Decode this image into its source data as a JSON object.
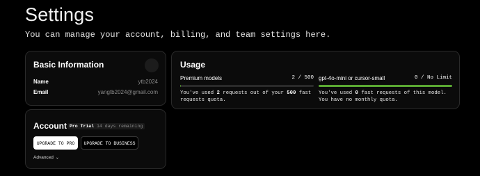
{
  "header": {
    "title": "Settings",
    "subtitle": "You can manage your account, billing, and team settings here."
  },
  "basic_info": {
    "title": "Basic Information",
    "name_label": "Name",
    "name_value": "ytb2024",
    "email_label": "Email",
    "email_value": "yangtb2024@gmail.com"
  },
  "account": {
    "title": "Account",
    "plan_badge": "Pro Trial",
    "trial_remaining": "14 days remaining",
    "upgrade_pro_label": "UPGRADE TO PRO",
    "upgrade_business_label": "UPGRADE TO BUSINESS",
    "advanced_label": "Advanced"
  },
  "usage": {
    "title": "Usage",
    "premium": {
      "name": "Premium models",
      "count": "2 / 500",
      "fill_fraction": 0.004,
      "desc_prefix": "You've used ",
      "desc_used": "2",
      "desc_middle": " requests out of your ",
      "desc_quota": "500",
      "desc_suffix": " fast requests quota."
    },
    "mini": {
      "name": "gpt-4o-mini or cursor-small",
      "count": "0 / No Limit",
      "fill_fraction": 1.0,
      "desc_prefix": "You've used ",
      "desc_used": "0",
      "desc_suffix": " fast requests of this model. You have no monthly quota."
    }
  },
  "colors": {
    "background": "#000000",
    "card": "#0b0b0b",
    "progress_fill": "#5aa832"
  }
}
